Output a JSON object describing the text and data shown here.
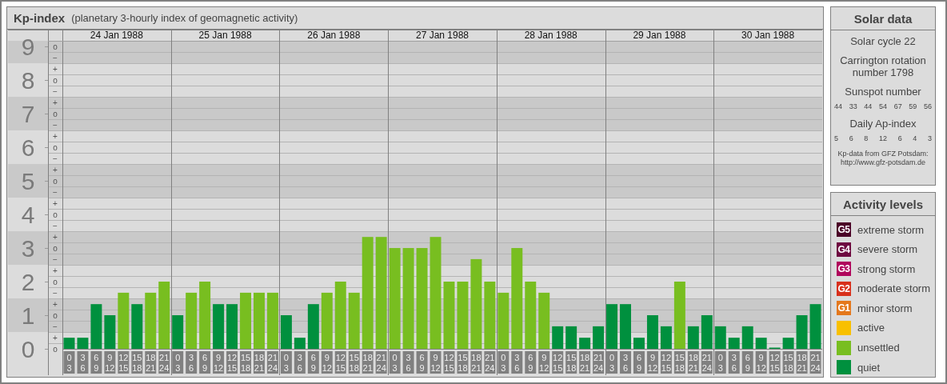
{
  "kp_panel": {
    "title": "Kp-index",
    "subtitle": "(planetary 3-hourly index of geomagnetic activity)",
    "days": [
      {
        "date": "24 Jan 1988",
        "slots": [
          {
            "start": "0",
            "end": "3"
          },
          {
            "start": "3",
            "end": "6"
          },
          {
            "start": "6",
            "end": "9"
          },
          {
            "start": "9",
            "end": "12"
          },
          {
            "start": "12",
            "end": "15"
          },
          {
            "start": "15",
            "end": "18"
          },
          {
            "start": "18",
            "end": "21"
          },
          {
            "start": "21",
            "end": "24"
          }
        ]
      },
      {
        "date": "25 Jan 1988",
        "slots": [
          {
            "start": "0",
            "end": "3"
          },
          {
            "start": "3",
            "end": "6"
          },
          {
            "start": "6",
            "end": "9"
          },
          {
            "start": "9",
            "end": "12"
          },
          {
            "start": "12",
            "end": "15"
          },
          {
            "start": "15",
            "end": "18"
          },
          {
            "start": "18",
            "end": "21"
          },
          {
            "start": "21",
            "end": "24"
          }
        ]
      },
      {
        "date": "26 Jan 1988",
        "slots": [
          {
            "start": "0",
            "end": "3"
          },
          {
            "start": "3",
            "end": "6"
          },
          {
            "start": "6",
            "end": "9"
          },
          {
            "start": "9",
            "end": "12"
          },
          {
            "start": "12",
            "end": "15"
          },
          {
            "start": "15",
            "end": "18"
          },
          {
            "start": "18",
            "end": "21"
          },
          {
            "start": "21",
            "end": "24"
          }
        ]
      },
      {
        "date": "27 Jan 1988",
        "slots": [
          {
            "start": "0",
            "end": "3"
          },
          {
            "start": "3",
            "end": "6"
          },
          {
            "start": "6",
            "end": "9"
          },
          {
            "start": "9",
            "end": "12"
          },
          {
            "start": "12",
            "end": "15"
          },
          {
            "start": "15",
            "end": "18"
          },
          {
            "start": "18",
            "end": "21"
          },
          {
            "start": "21",
            "end": "24"
          }
        ]
      },
      {
        "date": "28 Jan 1988",
        "slots": [
          {
            "start": "0",
            "end": "3"
          },
          {
            "start": "3",
            "end": "6"
          },
          {
            "start": "6",
            "end": "9"
          },
          {
            "start": "9",
            "end": "12"
          },
          {
            "start": "12",
            "end": "15"
          },
          {
            "start": "15",
            "end": "18"
          },
          {
            "start": "18",
            "end": "21"
          },
          {
            "start": "21",
            "end": "24"
          }
        ]
      },
      {
        "date": "29 Jan 1988",
        "slots": [
          {
            "start": "0",
            "end": "3"
          },
          {
            "start": "3",
            "end": "6"
          },
          {
            "start": "6",
            "end": "9"
          },
          {
            "start": "9",
            "end": "12"
          },
          {
            "start": "12",
            "end": "15"
          },
          {
            "start": "15",
            "end": "18"
          },
          {
            "start": "18",
            "end": "21"
          },
          {
            "start": "21",
            "end": "24"
          }
        ]
      },
      {
        "date": "30 Jan 1988",
        "slots": [
          {
            "start": "0",
            "end": "3"
          },
          {
            "start": "3",
            "end": "6"
          },
          {
            "start": "6",
            "end": "9"
          },
          {
            "start": "9",
            "end": "12"
          },
          {
            "start": "12",
            "end": "15"
          },
          {
            "start": "15",
            "end": "18"
          },
          {
            "start": "18",
            "end": "21"
          },
          {
            "start": "21",
            "end": "24"
          }
        ]
      }
    ],
    "chart_data": {
      "type": "bar",
      "stacked": true,
      "grid": true,
      "ylim": [
        0,
        9.17
      ],
      "yticks": [
        {
          "value": 0,
          "label": "0"
        },
        {
          "value": 1,
          "label": "1"
        },
        {
          "value": 2,
          "label": "2"
        },
        {
          "value": 3,
          "label": "3"
        },
        {
          "value": 4,
          "label": "4"
        },
        {
          "value": 5,
          "label": "5"
        },
        {
          "value": 6,
          "label": "6"
        },
        {
          "value": 7,
          "label": "7"
        },
        {
          "value": 8,
          "label": "8"
        },
        {
          "value": 9,
          "label": "9"
        }
      ],
      "series": [
        {
          "color": "#00903e",
          "values": [
            0.33,
            0.33,
            1.33,
            1,
            null,
            1.33,
            null,
            null,
            1,
            null,
            null,
            1.33,
            1.33,
            null,
            null,
            null,
            1,
            0.33,
            1.33,
            null,
            null,
            null,
            null,
            null,
            null,
            null,
            null,
            null,
            null,
            null,
            null,
            null,
            null,
            null,
            null,
            null,
            0.67,
            0.67,
            0.33,
            0.67,
            1.33,
            1.33,
            0.33,
            1,
            0.67,
            null,
            0.67,
            1,
            0.67,
            0.33,
            0.67,
            0.33,
            0,
            0.33,
            1,
            1.33
          ]
        },
        {
          "color": "#78be20",
          "values": [
            null,
            null,
            null,
            null,
            1.67,
            null,
            1.67,
            2,
            null,
            1.67,
            2,
            null,
            null,
            1.67,
            1.67,
            1.67,
            null,
            null,
            null,
            1.67,
            2,
            1.67,
            3.33,
            3.33,
            3,
            3,
            3,
            3.33,
            2,
            2,
            2.67,
            2,
            1.67,
            3,
            2,
            1.67,
            null,
            null,
            null,
            null,
            null,
            null,
            null,
            null,
            null,
            2,
            null,
            null,
            null,
            null,
            null,
            null,
            null,
            null,
            null,
            null
          ]
        }
      ]
    },
    "minor_axis_labels": [
      "o",
      "−",
      "+",
      "o",
      "−",
      "+",
      "o",
      "−",
      "+",
      "o",
      "−",
      "+",
      "o",
      "−",
      "+",
      "o",
      "−",
      "+",
      "o",
      "−",
      "+",
      "o",
      "−",
      "+",
      "o",
      "−",
      "+",
      "o"
    ]
  },
  "solar_data": {
    "title": "Solar data",
    "solar_cycle": "Solar cycle 22",
    "carrington": [
      "Carrington rotation",
      "number 1798"
    ],
    "sunspot_label": "Sunspot number",
    "sunspot_numbers": [
      "44",
      "33",
      "44",
      "54",
      "67",
      "59",
      "56"
    ],
    "ap_label": "Daily Ap-index",
    "ap_values": [
      "5",
      "6",
      "8",
      "12",
      "6",
      "4",
      "3"
    ],
    "source": [
      "Kp-data from GFZ Potsdam:",
      "http://www.gfz-potsdam.de"
    ]
  },
  "activity_levels": {
    "title": "Activity levels",
    "items": [
      {
        "code": "G5",
        "label": "extreme storm",
        "color": "#4a0026"
      },
      {
        "code": "G4",
        "label": "severe storm",
        "color": "#6e0840"
      },
      {
        "code": "G3",
        "label": "strong storm",
        "color": "#b0065c"
      },
      {
        "code": "G2",
        "label": "moderate storm",
        "color": "#d8301c"
      },
      {
        "code": "G1",
        "label": "minor storm",
        "color": "#e4781c"
      },
      {
        "label": "active",
        "color": "#f8c000"
      },
      {
        "label": "unsettled",
        "color": "#78be20"
      },
      {
        "label": "quiet",
        "color": "#00903e"
      }
    ]
  }
}
